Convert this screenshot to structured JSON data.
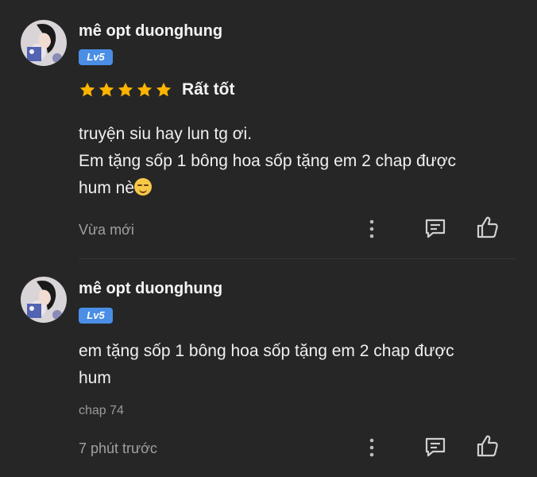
{
  "comments": [
    {
      "username": "mê opt duonghung",
      "level": "Lv5",
      "rating_label": "Rất tốt",
      "stars": 5,
      "lines": [
        "truyện siu hay lun tg ơi.",
        "Em tặng sốp 1 bông hoa sốp tặng em 2 chap được",
        "hum nè"
      ],
      "emoji": "smiling-face-emoji",
      "time": "Vừa mới"
    },
    {
      "username": "mê opt duonghung",
      "level": "Lv5",
      "lines": [
        "em tặng sốp 1 bông hoa sốp tặng em 2 chap được",
        "hum"
      ],
      "chapter": "chap 74",
      "time": "7 phút trước"
    }
  ],
  "colors": {
    "background": "#262626",
    "badge": "#4a8ee6",
    "star": "#ffb400",
    "meta_text": "#a0a0a0"
  },
  "icons": [
    "more-vertical-icon",
    "reply-comment-icon",
    "like-thumb-icon"
  ]
}
